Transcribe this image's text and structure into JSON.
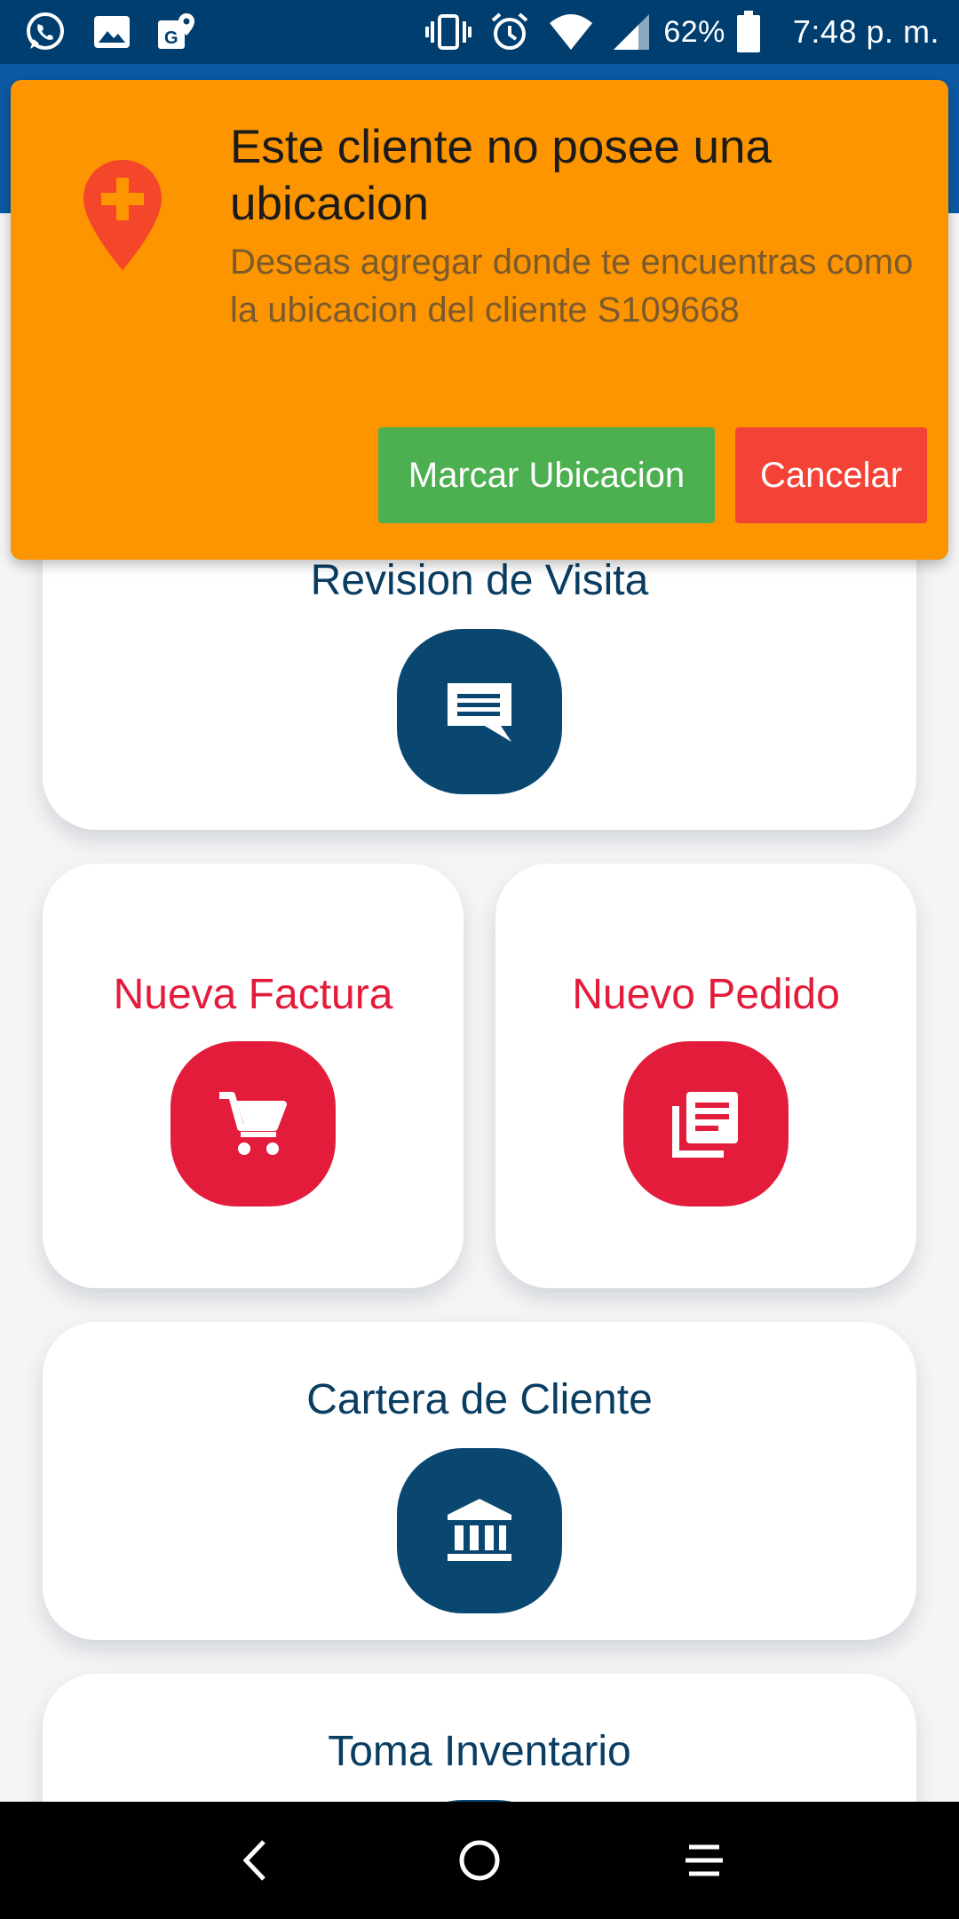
{
  "status_bar": {
    "battery": "62%",
    "time": "7:48 p. m.",
    "icons_left": [
      "whatsapp-icon",
      "gallery-icon",
      "maps-icon"
    ],
    "icons_right": [
      "vibrate-icon",
      "alarm-icon",
      "wifi-icon",
      "signal-icon",
      "battery-icon"
    ]
  },
  "dialog": {
    "title": "Este cliente no posee una ubicacion",
    "message": "Deseas agregar donde te encuentras como la ubicacion del cliente S109668",
    "confirm_label": "Marcar Ubicacion",
    "cancel_label": "Cancelar",
    "icon": "add-location-icon"
  },
  "cards": {
    "revision": {
      "title": "Revision de Visita",
      "icon": "message-icon"
    },
    "factura": {
      "title": "Nueva Factura",
      "icon": "cart-icon"
    },
    "pedido": {
      "title": "Nuevo Pedido",
      "icon": "document-icon"
    },
    "cartera": {
      "title": "Cartera de Cliente",
      "icon": "bank-icon"
    },
    "inventario": {
      "title": "Toma Inventario",
      "icon": "inventory-icon"
    }
  },
  "colors": {
    "status_bar": "#003e70",
    "dialog_bg": "#fd9500",
    "confirm": "#4caf50",
    "cancel": "#f44336",
    "primary_tile": "#0a4770",
    "accent_red": "#e31c3c"
  },
  "nav": [
    "back-icon",
    "home-icon",
    "menu-icon"
  ]
}
